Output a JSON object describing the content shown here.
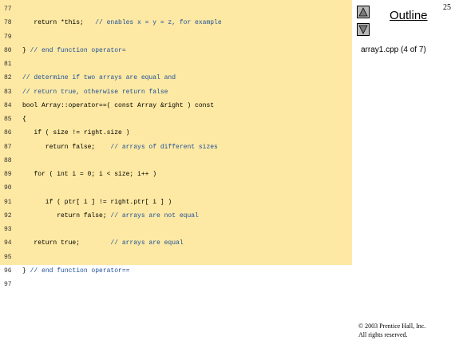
{
  "slide": {
    "number": "25"
  },
  "sidebar": {
    "title": "Outline",
    "file_label": "array1.cpp (4 of 7)",
    "up_icon": "triangle-up-icon",
    "down_icon": "triangle-down-icon"
  },
  "code": {
    "lines": [
      {
        "num": "77",
        "code": "",
        "comment": ""
      },
      {
        "num": "78",
        "code": "   return *this;   ",
        "comment": "// enables x = y = z, for example"
      },
      {
        "num": "79",
        "code": "",
        "comment": ""
      },
      {
        "num": "80",
        "code": "} ",
        "comment": "// end function operator="
      },
      {
        "num": "81",
        "code": "",
        "comment": ""
      },
      {
        "num": "82",
        "code": "",
        "comment": "// determine if two arrays are equal and"
      },
      {
        "num": "83",
        "code": "",
        "comment": "// return true, otherwise return false"
      },
      {
        "num": "84",
        "code": "bool Array::operator==( const Array &right ) const",
        "comment": ""
      },
      {
        "num": "85",
        "code": "{",
        "comment": ""
      },
      {
        "num": "86",
        "code": "   if ( size != right.size )",
        "comment": ""
      },
      {
        "num": "87",
        "code": "      return false;    ",
        "comment": "// arrays of different sizes"
      },
      {
        "num": "88",
        "code": "",
        "comment": ""
      },
      {
        "num": "89",
        "code": "   for ( int i = 0; i < size; i++ )",
        "comment": ""
      },
      {
        "num": "90",
        "code": "",
        "comment": ""
      },
      {
        "num": "91",
        "code": "      if ( ptr[ i ] != right.ptr[ i ] )",
        "comment": ""
      },
      {
        "num": "92",
        "code": "         return false; ",
        "comment": "// arrays are not equal"
      },
      {
        "num": "93",
        "code": "",
        "comment": ""
      },
      {
        "num": "94",
        "code": "   return true;        ",
        "comment": "// arrays are equal"
      },
      {
        "num": "95",
        "code": "",
        "comment": ""
      },
      {
        "num": "96",
        "code": "} ",
        "comment": "// end function operator=="
      },
      {
        "num": "97",
        "code": "",
        "comment": ""
      }
    ]
  },
  "footer": {
    "copyright_line1": "© 2003 Prentice Hall, Inc.",
    "copyright_line2": "All rights reserved."
  },
  "colors": {
    "code_background": "#fde9a3",
    "comment": "#1f4f9a",
    "button": "#b8b8b8"
  }
}
